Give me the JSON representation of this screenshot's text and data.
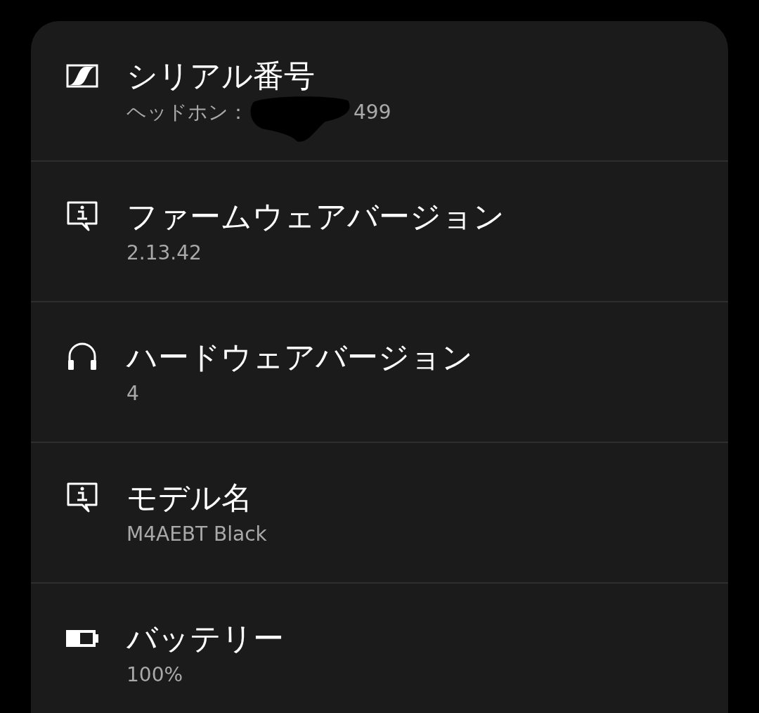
{
  "items": [
    {
      "kind": "brand",
      "title": "シリアル番号",
      "subtitle": "ヘッドホン：",
      "subtitle_end": "499",
      "redacted": true
    },
    {
      "kind": "info",
      "title": "ファームウェアバージョン",
      "subtitle": "2.13.42"
    },
    {
      "kind": "headphones",
      "title": "ハードウェアバージョン",
      "subtitle": "4"
    },
    {
      "kind": "info",
      "title": "モデル名",
      "subtitle": "M4AEBT Black"
    },
    {
      "kind": "battery",
      "title": "バッテリー",
      "subtitle": "100%"
    }
  ]
}
